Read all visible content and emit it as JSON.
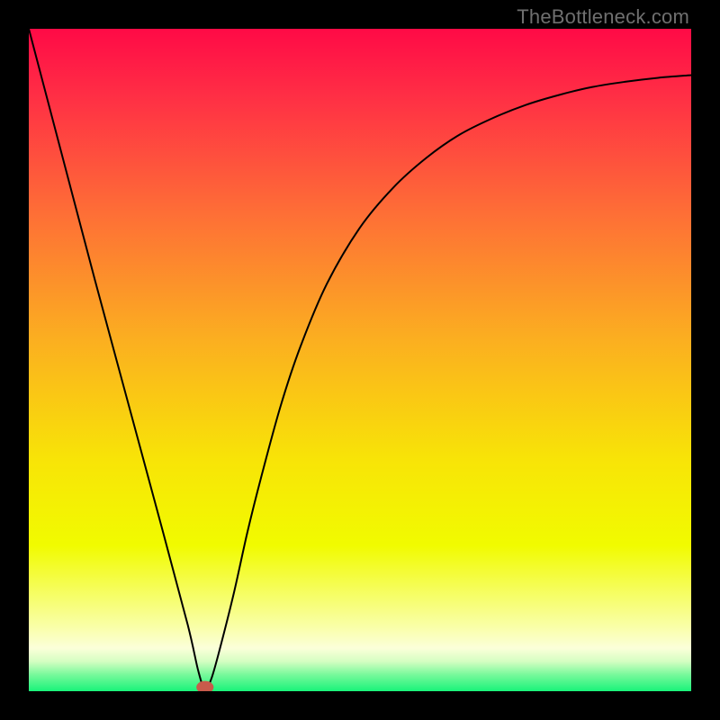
{
  "watermark": "TheBottleneck.com",
  "chart_data": {
    "type": "line",
    "title": "",
    "xlabel": "",
    "ylabel": "",
    "xlim": [
      0,
      100
    ],
    "ylim": [
      0,
      100
    ],
    "grid": false,
    "legend": false,
    "background_gradient": {
      "stops": [
        {
          "offset": 0.0,
          "color": "#ff0a46"
        },
        {
          "offset": 0.1,
          "color": "#ff2e45"
        },
        {
          "offset": 0.28,
          "color": "#fe6f36"
        },
        {
          "offset": 0.47,
          "color": "#fbaf20"
        },
        {
          "offset": 0.65,
          "color": "#f8e407"
        },
        {
          "offset": 0.78,
          "color": "#f1fb00"
        },
        {
          "offset": 0.9,
          "color": "#f9ffa4"
        },
        {
          "offset": 0.935,
          "color": "#fbffd9"
        },
        {
          "offset": 0.955,
          "color": "#d5fec2"
        },
        {
          "offset": 0.975,
          "color": "#78f99b"
        },
        {
          "offset": 1.0,
          "color": "#19f37a"
        }
      ]
    },
    "marker": {
      "x": 26.6,
      "y": 0.6,
      "color": "#c85b4b",
      "rx": 1.3,
      "ry": 0.95
    },
    "series": [
      {
        "name": "curve",
        "color": "#000000",
        "points": [
          {
            "x": 0.0,
            "y": 100.0
          },
          {
            "x": 5.0,
            "y": 81.0
          },
          {
            "x": 10.0,
            "y": 62.0
          },
          {
            "x": 15.0,
            "y": 43.5
          },
          {
            "x": 20.0,
            "y": 25.0
          },
          {
            "x": 24.0,
            "y": 10.0
          },
          {
            "x": 25.6,
            "y": 3.0
          },
          {
            "x": 26.6,
            "y": 0.3
          },
          {
            "x": 27.6,
            "y": 2.0
          },
          {
            "x": 29.0,
            "y": 7.0
          },
          {
            "x": 31.0,
            "y": 15.0
          },
          {
            "x": 33.0,
            "y": 24.0
          },
          {
            "x": 35.0,
            "y": 32.0
          },
          {
            "x": 38.0,
            "y": 43.0
          },
          {
            "x": 41.0,
            "y": 52.0
          },
          {
            "x": 45.0,
            "y": 61.5
          },
          {
            "x": 50.0,
            "y": 70.0
          },
          {
            "x": 55.0,
            "y": 76.0
          },
          {
            "x": 60.0,
            "y": 80.5
          },
          {
            "x": 65.0,
            "y": 84.0
          },
          {
            "x": 70.0,
            "y": 86.5
          },
          {
            "x": 75.0,
            "y": 88.5
          },
          {
            "x": 80.0,
            "y": 90.0
          },
          {
            "x": 85.0,
            "y": 91.2
          },
          {
            "x": 90.0,
            "y": 92.0
          },
          {
            "x": 95.0,
            "y": 92.6
          },
          {
            "x": 100.0,
            "y": 93.0
          }
        ]
      }
    ]
  }
}
